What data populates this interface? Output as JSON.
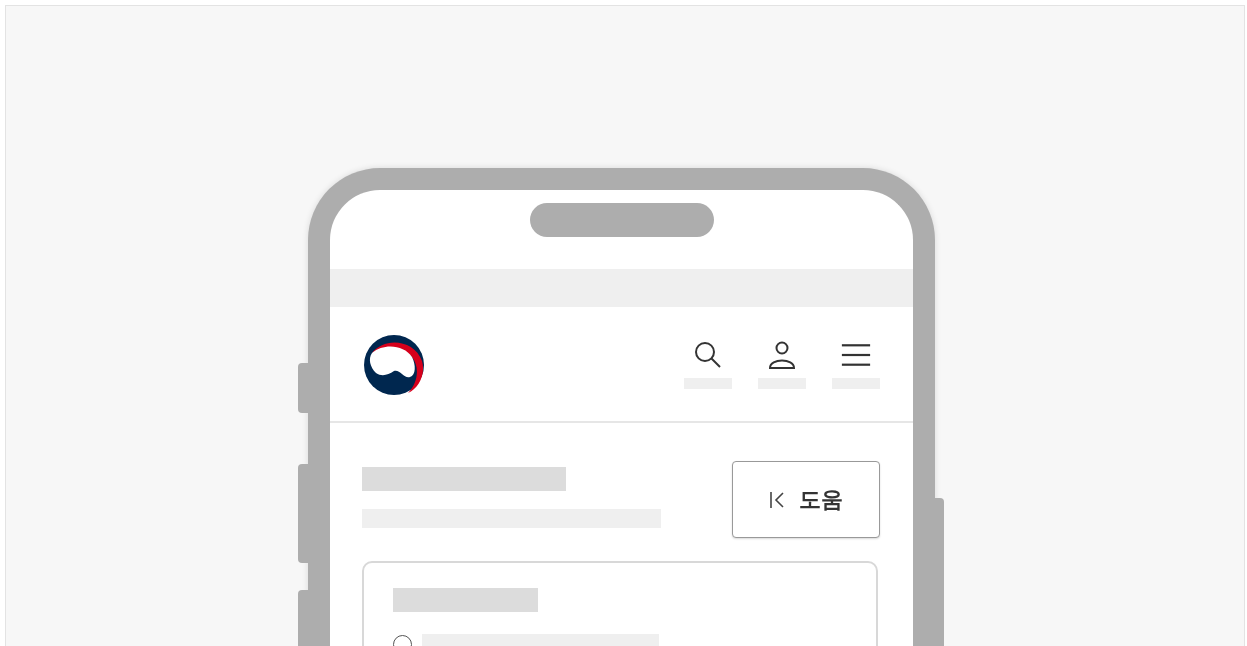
{
  "help_button": {
    "label": "도움"
  },
  "card": {
    "options": [
      {
        "selected": false
      }
    ]
  }
}
